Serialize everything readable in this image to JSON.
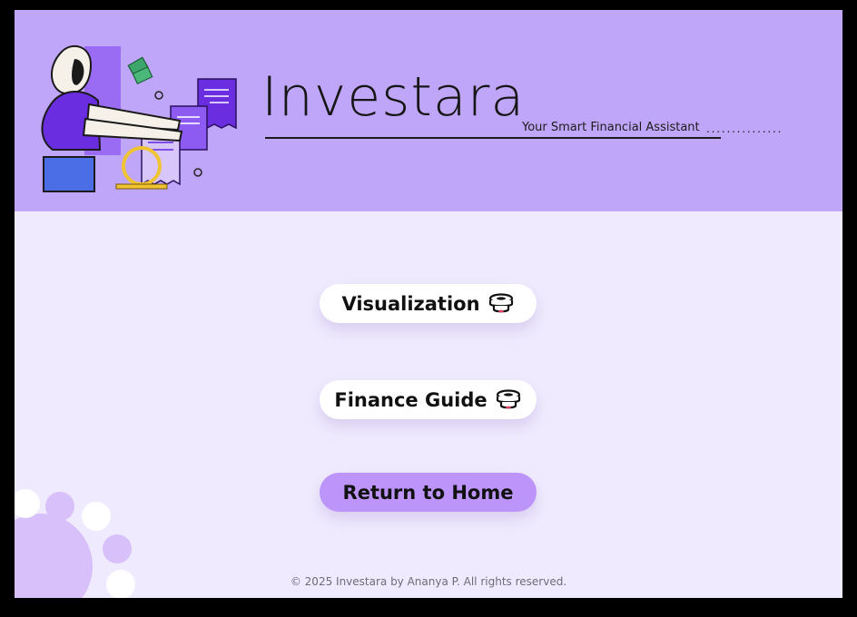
{
  "header": {
    "title": "Investara",
    "tagline": "Your Smart Financial Assistant",
    "tagline_dots": "..............."
  },
  "menu": {
    "visualization_label": "Visualization",
    "finance_guide_label": "Finance Guide",
    "return_home_label": "Return to Home"
  },
  "footer": {
    "text": "© 2025 Investara by Ananya P. All rights reserved."
  },
  "colors": {
    "header_bg": "#c0a6f8",
    "page_bg": "#efeafd",
    "accent_purple": "#bd94f9",
    "illustration_purple": "#6a2ee0"
  },
  "icons": [
    "finance-illustration",
    "coin-stack-icon",
    "decorative-blobs"
  ]
}
